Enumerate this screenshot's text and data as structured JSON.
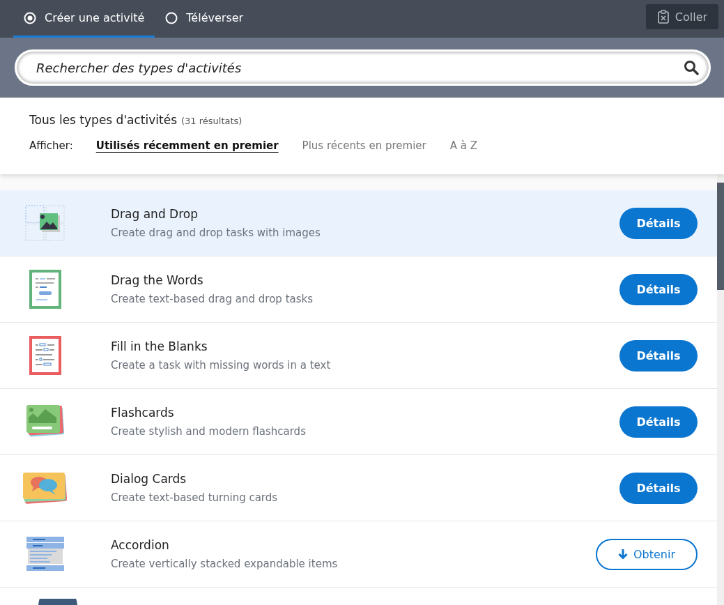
{
  "tabs": [
    {
      "label": "Créer une activité",
      "selected": true
    },
    {
      "label": "Téléverser",
      "selected": false
    }
  ],
  "paste_button": {
    "label": "Coller"
  },
  "search": {
    "placeholder": "Rechercher des types d'activités"
  },
  "results": {
    "title": "Tous les types d'activités",
    "count": "(31 résultats)",
    "sort_label": "Afficher:",
    "sort_options": [
      {
        "label": "Utilisés récemment en premier",
        "selected": true
      },
      {
        "label": "Plus récents en premier",
        "selected": false
      },
      {
        "label": "A à Z",
        "selected": false
      }
    ]
  },
  "activities": [
    {
      "title": "Drag and Drop",
      "description": "Create drag and drop tasks with images",
      "highlighted": true,
      "action": {
        "kind": "details",
        "label": "Détails"
      }
    },
    {
      "title": "Drag the Words",
      "description": "Create text-based drag and drop tasks",
      "highlighted": false,
      "action": {
        "kind": "details",
        "label": "Détails"
      }
    },
    {
      "title": "Fill in the Blanks",
      "description": "Create a task with missing words in a text",
      "highlighted": false,
      "action": {
        "kind": "details",
        "label": "Détails"
      }
    },
    {
      "title": "Flashcards",
      "description": "Create stylish and modern flashcards",
      "highlighted": false,
      "action": {
        "kind": "details",
        "label": "Détails"
      }
    },
    {
      "title": "Dialog Cards",
      "description": "Create text-based turning cards",
      "highlighted": false,
      "action": {
        "kind": "details",
        "label": "Détails"
      }
    },
    {
      "title": "Accordion",
      "description": "Create vertically stacked expandable items",
      "highlighted": false,
      "action": {
        "kind": "get",
        "label": "Obtenir"
      }
    }
  ]
}
